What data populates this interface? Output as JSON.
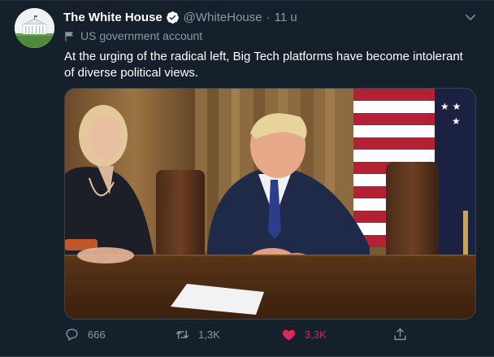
{
  "tweet": {
    "display_name": "The White House",
    "handle": "@WhiteHouse",
    "separator": "·",
    "time": "11 u",
    "account_label": "US government account",
    "text": "At the urging of the radical left, Big Tech platforms have become intolerant of diverse political views.",
    "media_type": "video-thumbnail"
  },
  "actions": {
    "replies": "666",
    "retweets": "1,3K",
    "likes": "3,3K",
    "liked": true
  },
  "icons": {
    "verified": "verified-badge-icon",
    "caret": "chevron-down-icon",
    "label": "flag-icon",
    "reply": "reply-icon",
    "retweet": "retweet-icon",
    "like": "heart-icon",
    "share": "share-icon"
  },
  "colors": {
    "background": "#15202b",
    "muted_text": "#8899a6",
    "accent": "#1da1f2",
    "like": "#e0245e"
  }
}
